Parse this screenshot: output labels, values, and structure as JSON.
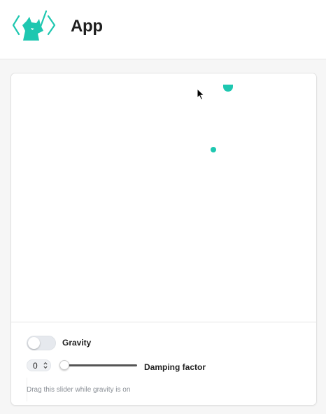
{
  "app": {
    "title": "App"
  },
  "colors": {
    "accent": "#1ec7b0",
    "logo": "#1ec7b0"
  },
  "icons": {
    "logo": "fox-code-logo",
    "cursor": "mouse-pointer-icon"
  },
  "controls": {
    "gravity": {
      "label": "Gravity",
      "on": false
    },
    "damping": {
      "value": "0",
      "label": "Damping factor",
      "slider_fraction": 0
    },
    "help_text": "Drag this slider while gravity is on"
  }
}
